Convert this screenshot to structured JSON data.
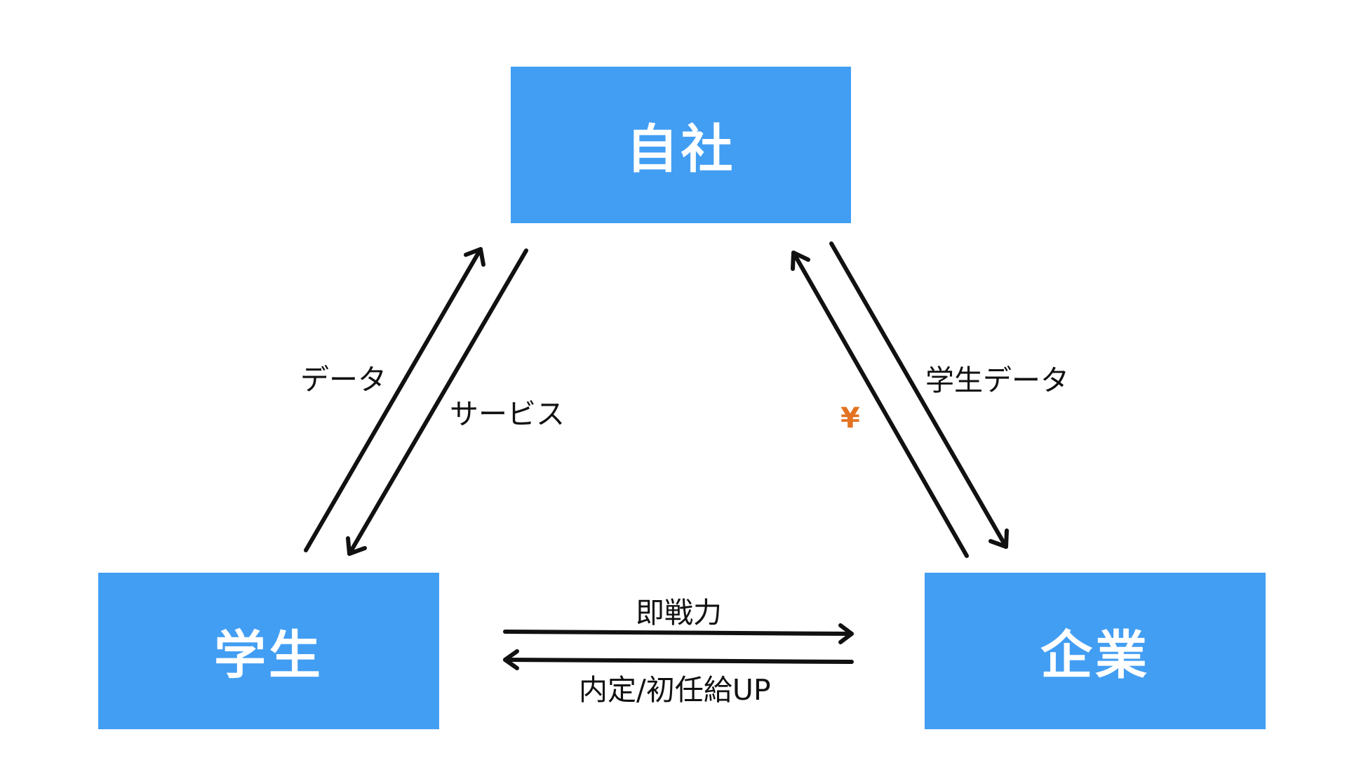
{
  "colors": {
    "node_fill": "#429EF3",
    "node_text": "#FFFFFF",
    "arrow": "#111111",
    "label_text": "#111111",
    "yen": "#E37322",
    "background": "#FFFFFF"
  },
  "nodes": {
    "company": "自社",
    "student": "学生",
    "enterprise": "企業"
  },
  "edges": {
    "student_to_company": "データ",
    "company_to_student": "サービス",
    "enterprise_to_company": "¥",
    "company_to_enterprise": "学生データ",
    "student_to_enterprise": "即戦力",
    "enterprise_to_student": "内定/初任給UP"
  }
}
